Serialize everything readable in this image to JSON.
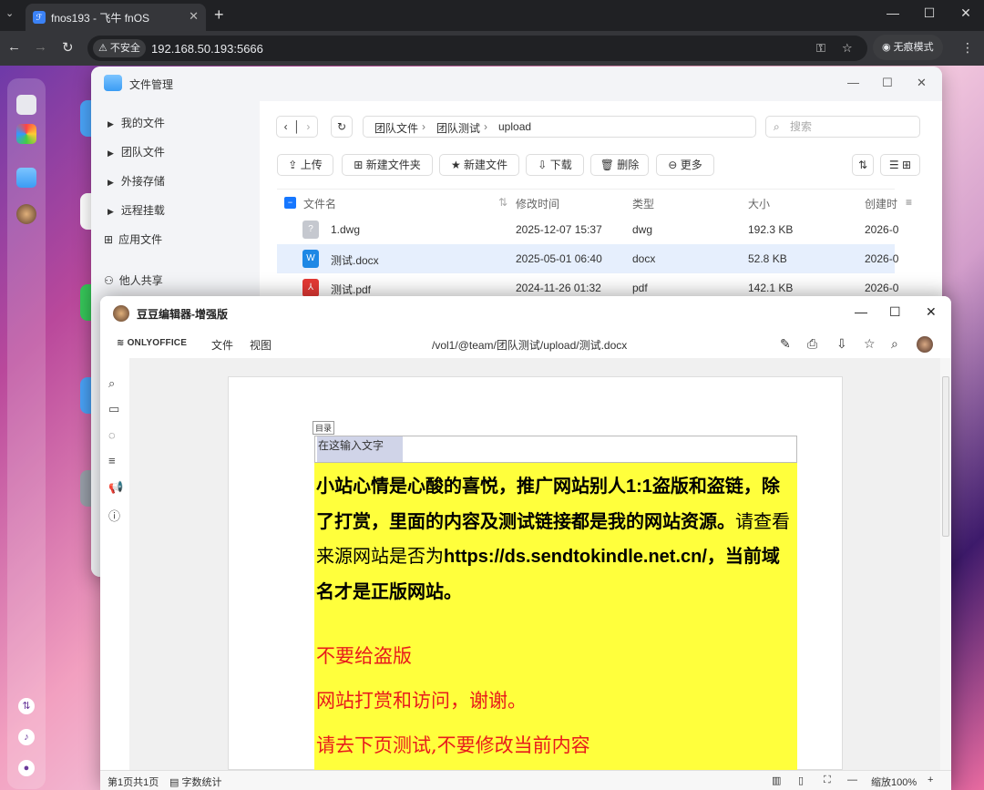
{
  "browser": {
    "tab_title": "fnos193 - 飞牛 fnOS",
    "security_label": "不安全",
    "url": "192.168.50.193:5666",
    "incognito_label": "无痕模式"
  },
  "file_manager": {
    "title": "文件管理",
    "sidebar": [
      {
        "label": "我的文件"
      },
      {
        "label": "团队文件"
      },
      {
        "label": "外接存储"
      },
      {
        "label": "远程挂载"
      },
      {
        "label": "应用文件"
      },
      {
        "label": "他人共享"
      }
    ],
    "breadcrumb": [
      "团队文件",
      "团队测试",
      "upload"
    ],
    "search_placeholder": "搜索",
    "toolbar": {
      "upload": "上传",
      "new_folder": "新建文件夹",
      "new_file": "新建文件",
      "download": "下载",
      "delete": "删除",
      "more": "更多"
    },
    "columns": [
      "文件名",
      "修改时间",
      "类型",
      "大小",
      "创建时"
    ],
    "rows": [
      {
        "name": "1.dwg",
        "modified": "2025-12-07 15:37",
        "type": "dwg",
        "size": "192.3 KB",
        "created": "2026-0"
      },
      {
        "name": "测试.docx",
        "modified": "2025-05-01 06:40",
        "type": "docx",
        "size": "52.8 KB",
        "created": "2026-0",
        "selected": true
      },
      {
        "name": "测试.pdf",
        "modified": "2024-11-26 01:32",
        "type": "pdf",
        "size": "142.1 KB",
        "created": "2026-0"
      }
    ]
  },
  "editor": {
    "title": "豆豆编辑器-增强版",
    "brand": "ONLYOFFICE",
    "menus": [
      "文件",
      "视图"
    ],
    "doc_path": "/vol1/@team/团队测试/upload/测试.docx",
    "toc_tag": "目录",
    "toc_placeholder": "在这输入文字",
    "para_1": "小站心情是心酸的喜悦，推广网站别人",
    "para_ratio": "1:1",
    "para_2": "盗版和盗链，除了打赏，里面的内容及测试链接都是我的网站资源。",
    "para_3": "请查看来源网站是否为",
    "para_url": "https://ds.sendtokindle.net.cn/",
    "para_4": "，当前域名才是正版网站。",
    "red_1": "不要给盗版",
    "red_2": "网站打赏和访问，谢谢。",
    "red_3": "请去下页测试,不要修改当前内容",
    "status_pages": "第1页共1页",
    "status_wordcount": "字数统计",
    "status_zoom": "缩放100%"
  }
}
